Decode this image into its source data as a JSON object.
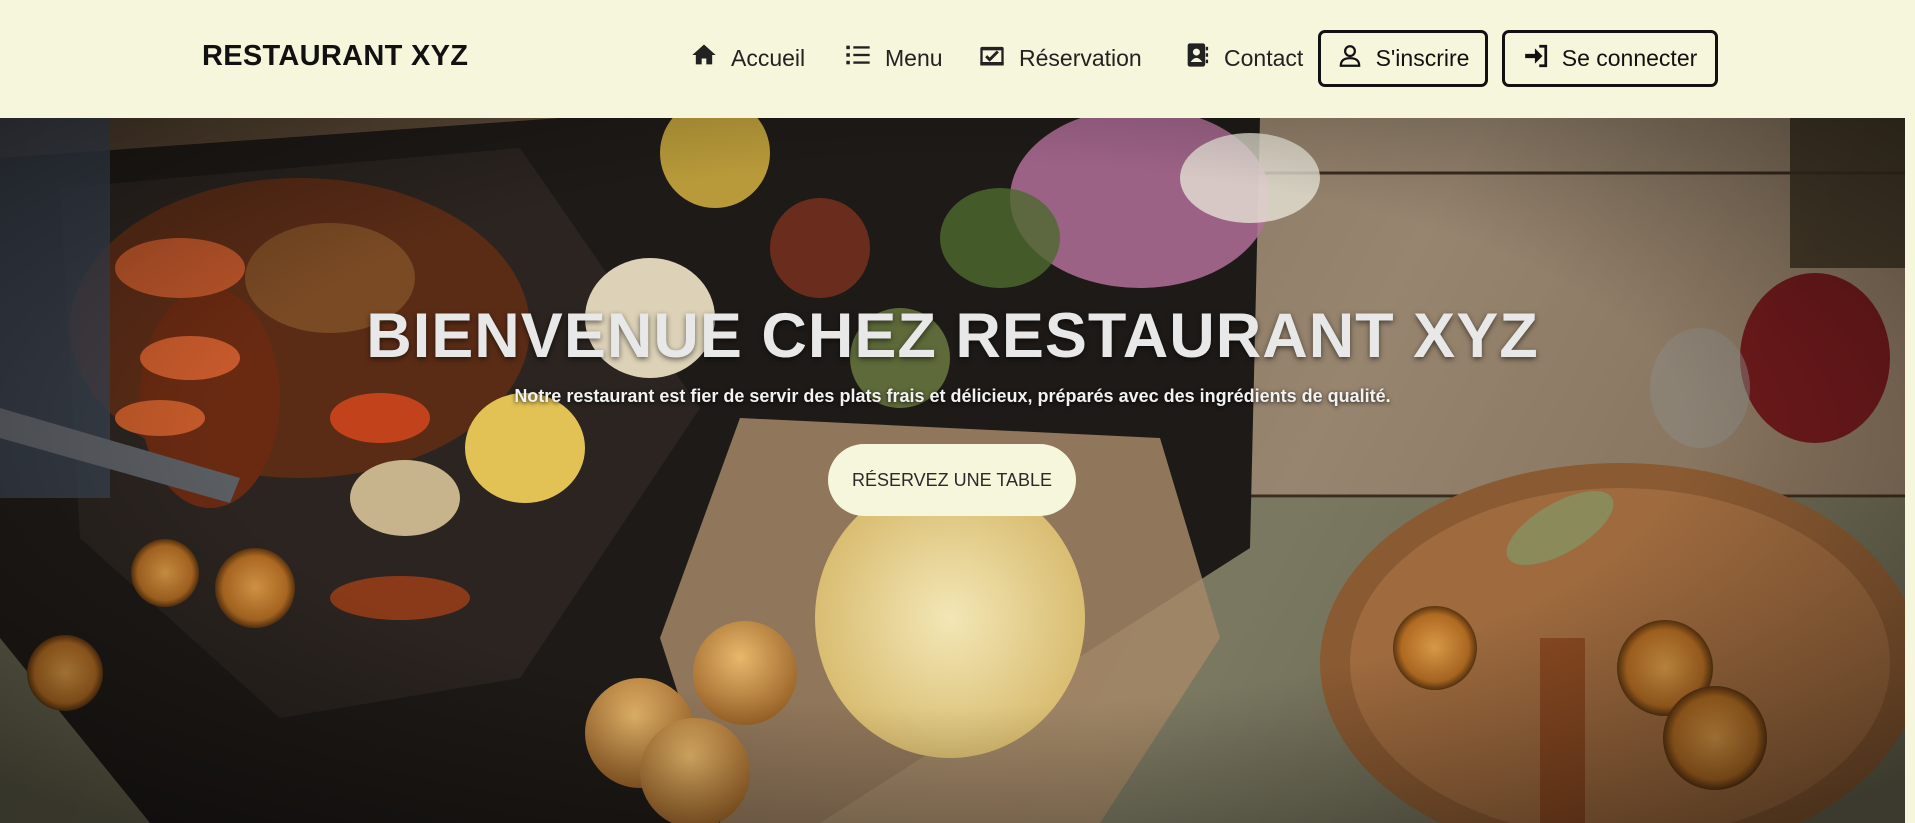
{
  "brand": {
    "name": "RESTAURANT XYZ"
  },
  "nav": {
    "links": [
      {
        "label": "Accueil",
        "icon": "home-icon"
      },
      {
        "label": "Menu",
        "icon": "list-icon"
      },
      {
        "label": "Réservation",
        "icon": "calendar-check-icon"
      },
      {
        "label": "Contact",
        "icon": "address-book-icon"
      }
    ],
    "register_label": "S'inscrire",
    "register_icon": "user-icon",
    "login_label": "Se connecter",
    "login_icon": "sign-in-icon"
  },
  "hero": {
    "title": "BIENVENUE CHEZ RESTAURANT XYZ",
    "subtitle": "Notre restaurant est fier de servir des plats frais et délicieux, préparés avec des ingrédients de qualité.",
    "cta_label": "RÉSERVEZ UNE TABLE",
    "image": "food-table-photo"
  },
  "colors": {
    "navbar_bg": "#f6f6dc",
    "cta_bg": "#f6f6dc",
    "text_dark": "#111111"
  }
}
